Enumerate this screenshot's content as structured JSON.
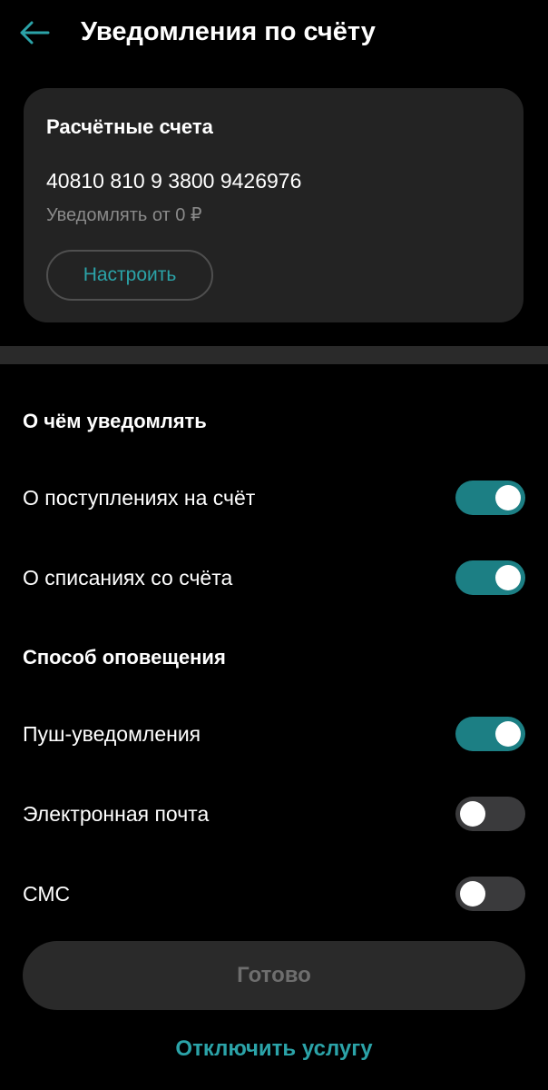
{
  "header": {
    "back_icon": "arrow-left-icon",
    "title": "Уведомления по счёту"
  },
  "account_card": {
    "title": "Расчётные счета",
    "account_number": "40810 810 9 3800 9426976",
    "threshold": "Уведомлять от 0 ₽",
    "setup_label": "Настроить"
  },
  "what_section": {
    "title": "О чём уведомлять",
    "items": [
      {
        "label": "О поступлениях на счёт",
        "enabled": true
      },
      {
        "label": "О списаниях со счёта",
        "enabled": true
      }
    ]
  },
  "method_section": {
    "title": "Способ оповещения",
    "items": [
      {
        "label": "Пуш-уведомления",
        "enabled": true
      },
      {
        "label": "Электронная почта",
        "enabled": false
      },
      {
        "label": "СМС",
        "enabled": false
      }
    ]
  },
  "actions": {
    "done_label": "Готово",
    "disable_label": "Отключить услугу"
  },
  "colors": {
    "accent": "#2ba3a8",
    "toggle_on": "#1c7f84",
    "toggle_off": "#3a3a3c",
    "card_bg": "#232323",
    "background": "#000000"
  }
}
